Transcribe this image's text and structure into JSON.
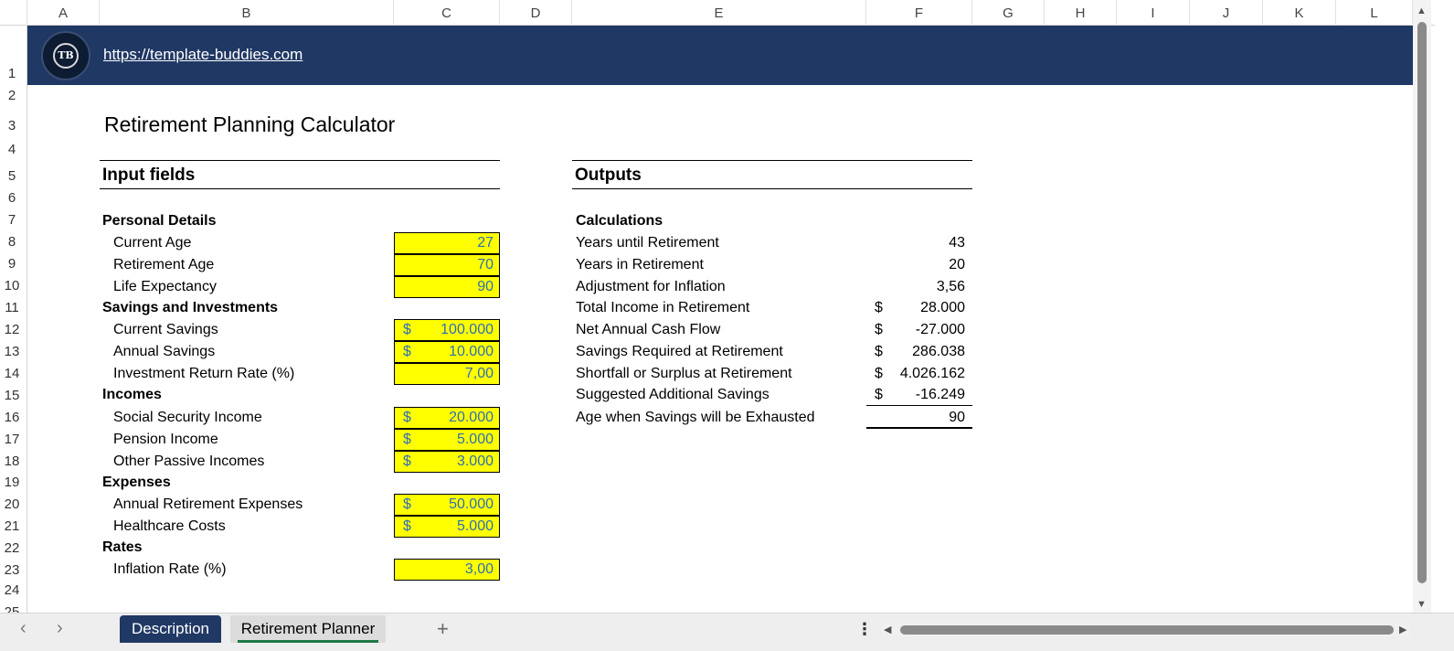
{
  "columns": [
    "A",
    "B",
    "C",
    "D",
    "E",
    "F",
    "G",
    "H",
    "I",
    "J",
    "K",
    "L"
  ],
  "rows": [
    "1",
    "2",
    "3",
    "4",
    "5",
    "6",
    "7",
    "8",
    "9",
    "10",
    "11",
    "12",
    "13",
    "14",
    "15",
    "16",
    "17",
    "18",
    "19",
    "20",
    "21",
    "22",
    "23",
    "24",
    "25"
  ],
  "banner": {
    "logo_text": "TB",
    "url": "https://template-buddies.com"
  },
  "title": "Retirement Planning Calculator",
  "inputs": {
    "header": "Input fields",
    "personal": {
      "heading": "Personal Details",
      "current_age_label": "Current Age",
      "current_age": "27",
      "retirement_age_label": "Retirement Age",
      "retirement_age": "70",
      "life_expectancy_label": "Life Expectancy",
      "life_expectancy": "90"
    },
    "savings": {
      "heading": "Savings and Investments",
      "current_savings_label": "Current Savings",
      "current_savings": "100.000",
      "annual_savings_label": "Annual Savings",
      "annual_savings": "10.000",
      "return_rate_label": "Investment Return Rate (%)",
      "return_rate": "7,00"
    },
    "incomes": {
      "heading": "Incomes",
      "social_label": "Social Security Income",
      "social": "20.000",
      "pension_label": "Pension Income",
      "pension": "5.000",
      "passive_label": "Other Passive Incomes",
      "passive": "3.000"
    },
    "expenses": {
      "heading": "Expenses",
      "annual_label": "Annual Retirement Expenses",
      "annual": "50.000",
      "health_label": "Healthcare Costs",
      "health": "5.000"
    },
    "rates": {
      "heading": "Rates",
      "inflation_label": "Inflation Rate (%)",
      "inflation": "3,00"
    },
    "currency": "$"
  },
  "outputs": {
    "header": "Outputs",
    "heading": "Calculations",
    "years_until_label": "Years until Retirement",
    "years_until": "43",
    "years_in_label": "Years in Retirement",
    "years_in": "20",
    "inflation_adj_label": "Adjustment for Inflation",
    "inflation_adj": "3,56",
    "total_income_label": "Total Income in Retirement",
    "total_income": "28.000",
    "net_cash_label": "Net Annual Cash Flow",
    "net_cash": "-27.000",
    "savings_req_label": "Savings Required at Retirement",
    "savings_req": "286.038",
    "shortfall_label": "Shortfall or Surplus at Retirement",
    "shortfall": "4.026.162",
    "suggested_label": "Suggested Additional Savings",
    "suggested": "-16.249",
    "exhausted_label": "Age when Savings will be Exhausted",
    "exhausted": "90",
    "currency": "$"
  },
  "sheet_tabs": {
    "description": "Description",
    "active": "Retirement Planner",
    "add": "+"
  },
  "icons": {
    "nav_prev": "chevron-left-icon",
    "nav_next": "chevron-right-icon",
    "more": "more-options-icon"
  }
}
